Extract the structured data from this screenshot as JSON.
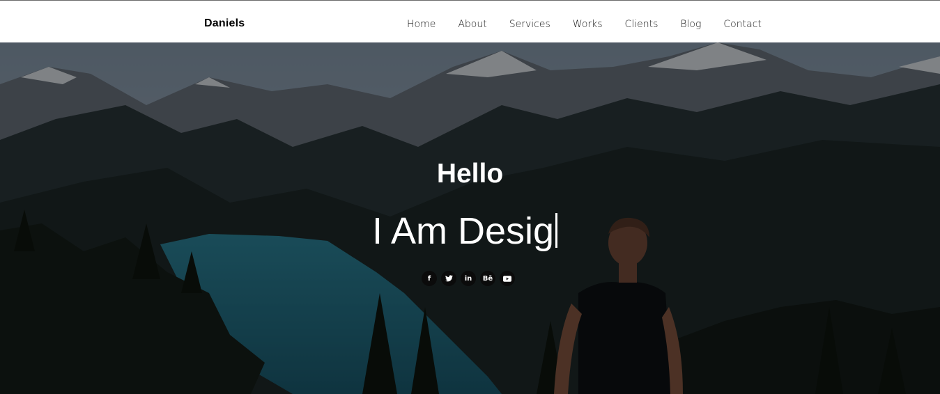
{
  "brand": "Daniels",
  "nav": {
    "items": [
      {
        "label": "Home"
      },
      {
        "label": "About"
      },
      {
        "label": "Services"
      },
      {
        "label": "Works"
      },
      {
        "label": "Clients"
      },
      {
        "label": "Blog"
      },
      {
        "label": "Contact"
      }
    ]
  },
  "hero": {
    "greeting": "Hello",
    "typed_text": "I Am Desig"
  },
  "social": [
    {
      "icon": "facebook-icon",
      "glyph": "f"
    },
    {
      "icon": "twitter-icon",
      "glyph": "🐦"
    },
    {
      "icon": "linkedin-icon",
      "glyph": "in"
    },
    {
      "icon": "behance-icon",
      "glyph": "Bē"
    },
    {
      "icon": "youtube-icon",
      "glyph": "▶"
    }
  ],
  "colors": {
    "navbar_bg": "#ffffff",
    "hero_overlay": "rgba(0,0,0,0.45)",
    "text_on_hero": "#ffffff"
  }
}
